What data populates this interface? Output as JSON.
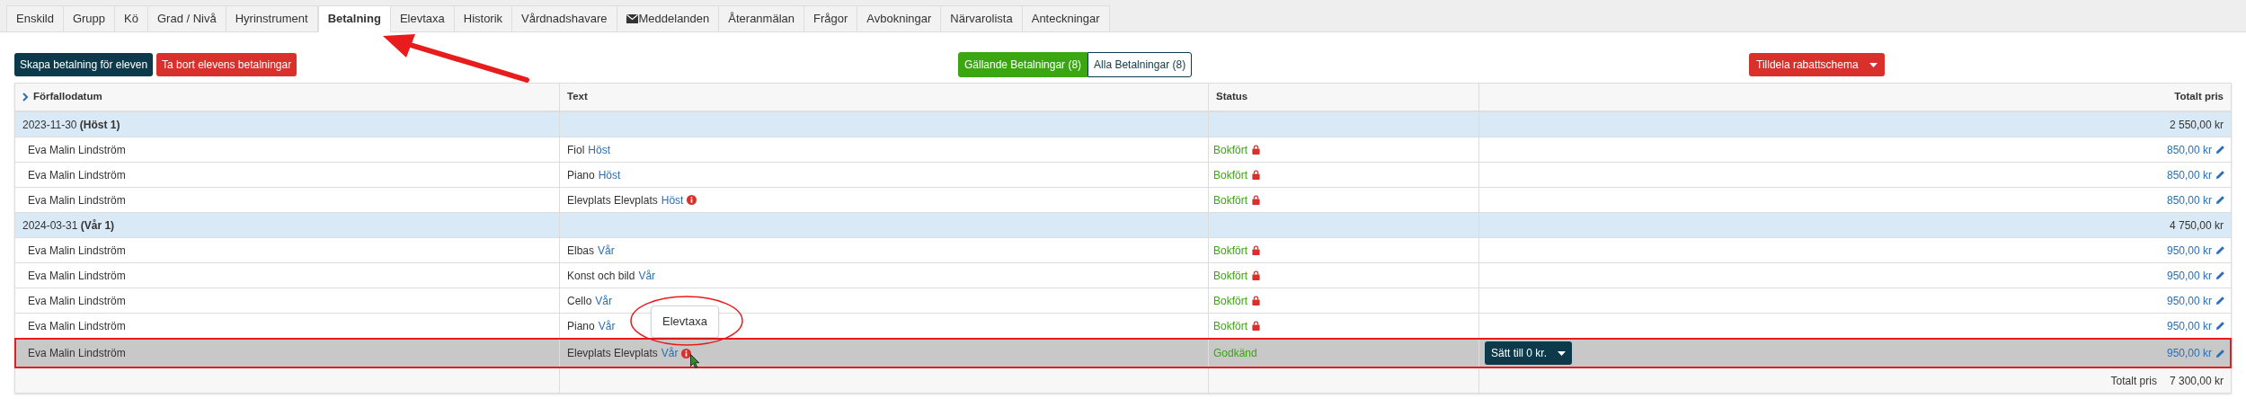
{
  "tabs": [
    {
      "label": "Enskild",
      "selected": false,
      "kind": "plain"
    },
    {
      "label": "Grupp",
      "selected": false,
      "kind": "plain"
    },
    {
      "label": "Kö",
      "selected": false,
      "kind": "plain"
    },
    {
      "label": "Grad / Nivå",
      "selected": false,
      "kind": "plain"
    },
    {
      "label": "Hyrinstrument",
      "selected": false,
      "kind": "plain"
    },
    {
      "label": "Betalning",
      "selected": true,
      "kind": "plain"
    },
    {
      "label": "Elevtaxa",
      "selected": false,
      "kind": "plain"
    },
    {
      "label": "Historik",
      "selected": false,
      "kind": "plain"
    },
    {
      "label": "Vårdnadshavare",
      "selected": false,
      "kind": "plain"
    },
    {
      "label": "Meddelanden",
      "selected": false,
      "kind": "mail"
    },
    {
      "label": "Återanmälan",
      "selected": false,
      "kind": "plain"
    },
    {
      "label": "Frågor",
      "selected": false,
      "kind": "plain"
    },
    {
      "label": "Avbokningar",
      "selected": false,
      "kind": "plain"
    },
    {
      "label": "Närvarolista",
      "selected": false,
      "kind": "plain"
    },
    {
      "label": "Anteckningar",
      "selected": false,
      "kind": "plain"
    }
  ],
  "actions": [
    {
      "label": "Skapa betalning för eleven",
      "kind": "primary"
    },
    {
      "label": "Ta bort elevens betalningar",
      "kind": "danger"
    }
  ],
  "filters": [
    {
      "label": "Gällande Betalningar (8)",
      "selected": true
    },
    {
      "label": "Alla Betalningar (8)",
      "selected": false
    }
  ],
  "discount_button": {
    "label": "Tilldela rabattschema"
  },
  "table": {
    "columns": [
      {
        "label": "Förfallodatum",
        "kind": "expander"
      },
      {
        "label": "Text",
        "kind": "plain"
      },
      {
        "label": "Status",
        "kind": "plain"
      },
      {
        "label": "Totalt pris",
        "kind": "plain"
      }
    ],
    "groups": [
      {
        "date": "2023-11-30",
        "term": "(Höst 1)",
        "total": "2 550,00 kr",
        "rows": [
          {
            "name": "Eva Malin Lindström",
            "item": "Fiol",
            "term": "Höst",
            "info": false,
            "status": "Bokfört",
            "locked": true,
            "price": "850,00 kr",
            "selected": false
          },
          {
            "name": "Eva Malin Lindström",
            "item": "Piano",
            "term": "Höst",
            "info": false,
            "status": "Bokfört",
            "locked": true,
            "price": "850,00 kr",
            "selected": false
          },
          {
            "name": "Eva Malin Lindström",
            "item": "Elevplats Elevplats",
            "term": "Höst",
            "info": true,
            "status": "Bokfört",
            "locked": true,
            "price": "850,00 kr",
            "selected": false
          }
        ]
      },
      {
        "date": "2024-03-31",
        "term": "(Vår 1)",
        "total": "4 750,00 kr",
        "rows": [
          {
            "name": "Eva Malin Lindström",
            "item": "Elbas",
            "term": "Vår",
            "info": false,
            "status": "Bokfört",
            "locked": true,
            "price": "950,00 kr",
            "selected": false
          },
          {
            "name": "Eva Malin Lindström",
            "item": "Konst och bild",
            "term": "Vår",
            "info": false,
            "status": "Bokfört",
            "locked": true,
            "price": "950,00 kr",
            "selected": false
          },
          {
            "name": "Eva Malin Lindström",
            "item": "Cello",
            "term": "Vår",
            "info": false,
            "status": "Bokfört",
            "locked": true,
            "price": "950,00 kr",
            "selected": false
          },
          {
            "name": "Eva Malin Lindström",
            "item": "Piano",
            "term": "Vår",
            "info": false,
            "status": "Bokfört",
            "locked": true,
            "price": "950,00 kr",
            "selected": false
          },
          {
            "name": "Eva Malin Lindström",
            "item": "Elevplats Elevplats",
            "term": "Vår",
            "info": true,
            "status": "Godkänd",
            "locked": false,
            "price": "950,00 kr",
            "selected": true,
            "action": "Sätt till 0 kr.",
            "tooltip": "Elevtaxa"
          }
        ]
      }
    ],
    "footer": {
      "label": "Totalt pris",
      "value": "7 300,00 kr"
    }
  }
}
